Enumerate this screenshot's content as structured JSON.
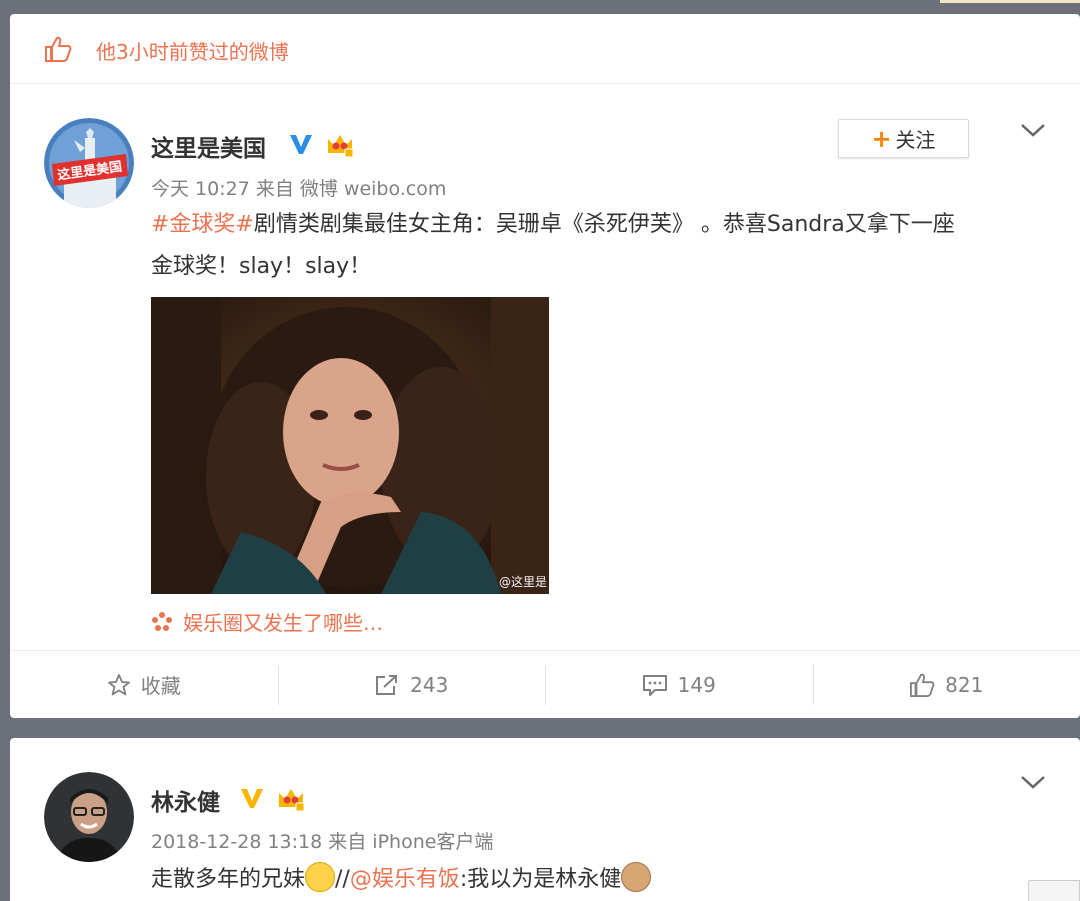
{
  "liked_notice": {
    "text": "他3小时前赞过的微博",
    "icon": "thumbs-up-icon"
  },
  "post1": {
    "user": {
      "name": "这里是美国",
      "avatar_text": "这里是美国"
    },
    "follow_label": "关注",
    "meta": "今天 10:27 来自 微博 weibo.com",
    "hashtag": "#金球奖#",
    "text_line1_rest": "剧情类剧集最佳女主角：吴珊卓《杀死伊芙》 。恭喜Sandra又拿下一座",
    "text_line2": "金球奖！slay！slay！",
    "image_watermark": "@这里是",
    "source": "娱乐圈又发生了哪些…",
    "actions": {
      "favorite": "收藏",
      "repost": "243",
      "comment": "149",
      "like": "821"
    }
  },
  "post2": {
    "user": {
      "name": "林永健"
    },
    "meta": "2018-12-28 13:18 来自 iPhone客户端",
    "text_before": "走散多年的兄妹",
    "slashes": "//",
    "mention": "@娱乐有饭",
    "text_after": ":我以为是林永健"
  },
  "colors": {
    "accent": "#eb7350",
    "follow_plus": "#ff8200",
    "verified": "#2a8de6",
    "verified_gold": "#f8b500",
    "text": "#333333",
    "meta": "#808080"
  }
}
